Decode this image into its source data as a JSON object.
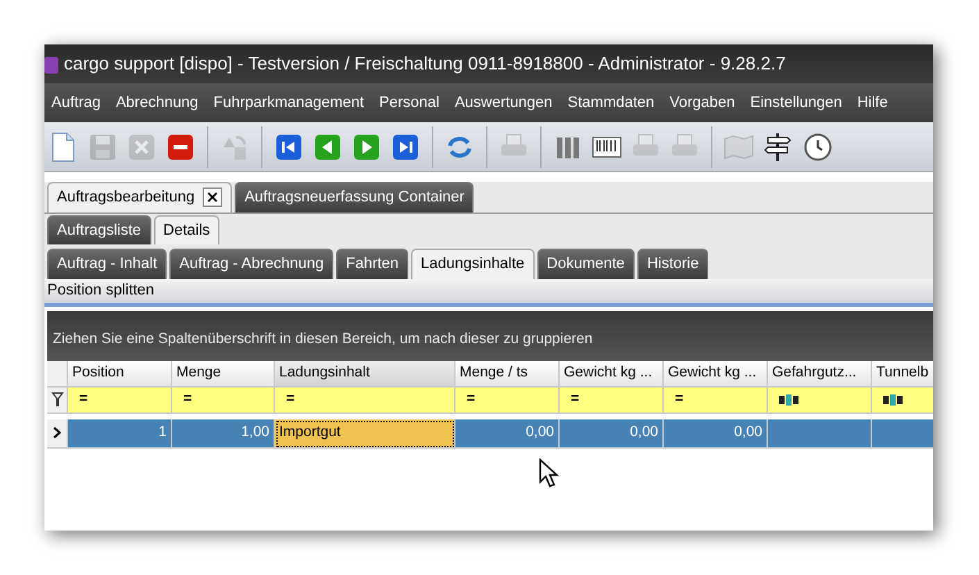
{
  "window": {
    "title": "cargo support [dispo] - Testversion / Freischaltung 0911-8918800 - Administrator - 9.28.2.7"
  },
  "menu": [
    "Auftrag",
    "Abrechnung",
    "Fuhrparkmanagement",
    "Personal",
    "Auswertungen",
    "Stammdaten",
    "Vorgaben",
    "Einstellungen",
    "Hilfe"
  ],
  "toolbar": [
    {
      "kind": "new",
      "disabled": false
    },
    {
      "kind": "save",
      "disabled": true
    },
    {
      "kind": "cancel",
      "disabled": true
    },
    {
      "kind": "remove",
      "disabled": false
    },
    {
      "kind": "sep"
    },
    {
      "kind": "copy",
      "disabled": true
    },
    {
      "kind": "sep"
    },
    {
      "kind": "first",
      "disabled": false
    },
    {
      "kind": "prev",
      "disabled": false
    },
    {
      "kind": "next",
      "disabled": false
    },
    {
      "kind": "last",
      "disabled": false
    },
    {
      "kind": "sep"
    },
    {
      "kind": "refresh",
      "disabled": false
    },
    {
      "kind": "sep"
    },
    {
      "kind": "print",
      "disabled": true
    },
    {
      "kind": "sep"
    },
    {
      "kind": "binders",
      "disabled": false
    },
    {
      "kind": "barcode",
      "disabled": false
    },
    {
      "kind": "print",
      "disabled": true
    },
    {
      "kind": "printsave",
      "disabled": true
    },
    {
      "kind": "sep"
    },
    {
      "kind": "map",
      "disabled": true
    },
    {
      "kind": "signpost",
      "disabled": false
    },
    {
      "kind": "clock",
      "disabled": false
    }
  ],
  "document_tabs": [
    {
      "label": "Auftragsbearbeitung",
      "selected": true,
      "closable": true
    },
    {
      "label": "Auftragsneuerfassung Container",
      "selected": false,
      "closable": false
    }
  ],
  "view_tabs": [
    {
      "label": "Auftragsliste",
      "selected": false
    },
    {
      "label": "Details",
      "selected": true
    }
  ],
  "detail_tabs": [
    {
      "label": "Auftrag - Inhalt",
      "selected": false
    },
    {
      "label": "Auftrag - Abrechnung",
      "selected": false
    },
    {
      "label": "Fahrten",
      "selected": false
    },
    {
      "label": "Ladungsinhalte",
      "selected": true
    },
    {
      "label": "Dokumente",
      "selected": false
    },
    {
      "label": "Historie",
      "selected": false
    }
  ],
  "action_bar": {
    "label": "Position splitten"
  },
  "grid": {
    "group_hint": "Ziehen Sie eine Spaltenüberschrift in diesen Bereich, um nach dieser zu gruppieren",
    "columns": [
      {
        "label": "Position",
        "sorted": false,
        "filter": {
          "kind": "operator",
          "symbol": "="
        }
      },
      {
        "label": "Menge",
        "sorted": false,
        "filter": {
          "kind": "operator",
          "symbol": "="
        }
      },
      {
        "label": "Ladungsinhalt",
        "sorted": true,
        "filter": {
          "kind": "operator",
          "symbol": "="
        }
      },
      {
        "label": "Menge / ts",
        "sorted": false,
        "filter": {
          "kind": "operator",
          "symbol": "="
        }
      },
      {
        "label": "Gewicht kg ...",
        "sorted": false,
        "filter": {
          "kind": "operator",
          "symbol": "="
        }
      },
      {
        "label": "Gewicht kg ...",
        "sorted": false,
        "filter": {
          "kind": "operator",
          "symbol": "="
        }
      },
      {
        "label": "Gefahrgutz...",
        "sorted": false,
        "filter": {
          "kind": "text"
        }
      },
      {
        "label": "Tunnelb",
        "sorted": false,
        "filter": {
          "kind": "text"
        }
      }
    ],
    "rows": [
      {
        "selected": true,
        "cells": [
          {
            "text": "1",
            "focused": false
          },
          {
            "text": "1,00",
            "focused": false
          },
          {
            "text": "Importgut",
            "focused": true
          },
          {
            "text": "0,00",
            "focused": false
          },
          {
            "text": "0,00",
            "focused": false
          },
          {
            "text": "0,00",
            "focused": false
          },
          {
            "focused": false
          },
          {
            "focused": false
          }
        ]
      }
    ]
  }
}
